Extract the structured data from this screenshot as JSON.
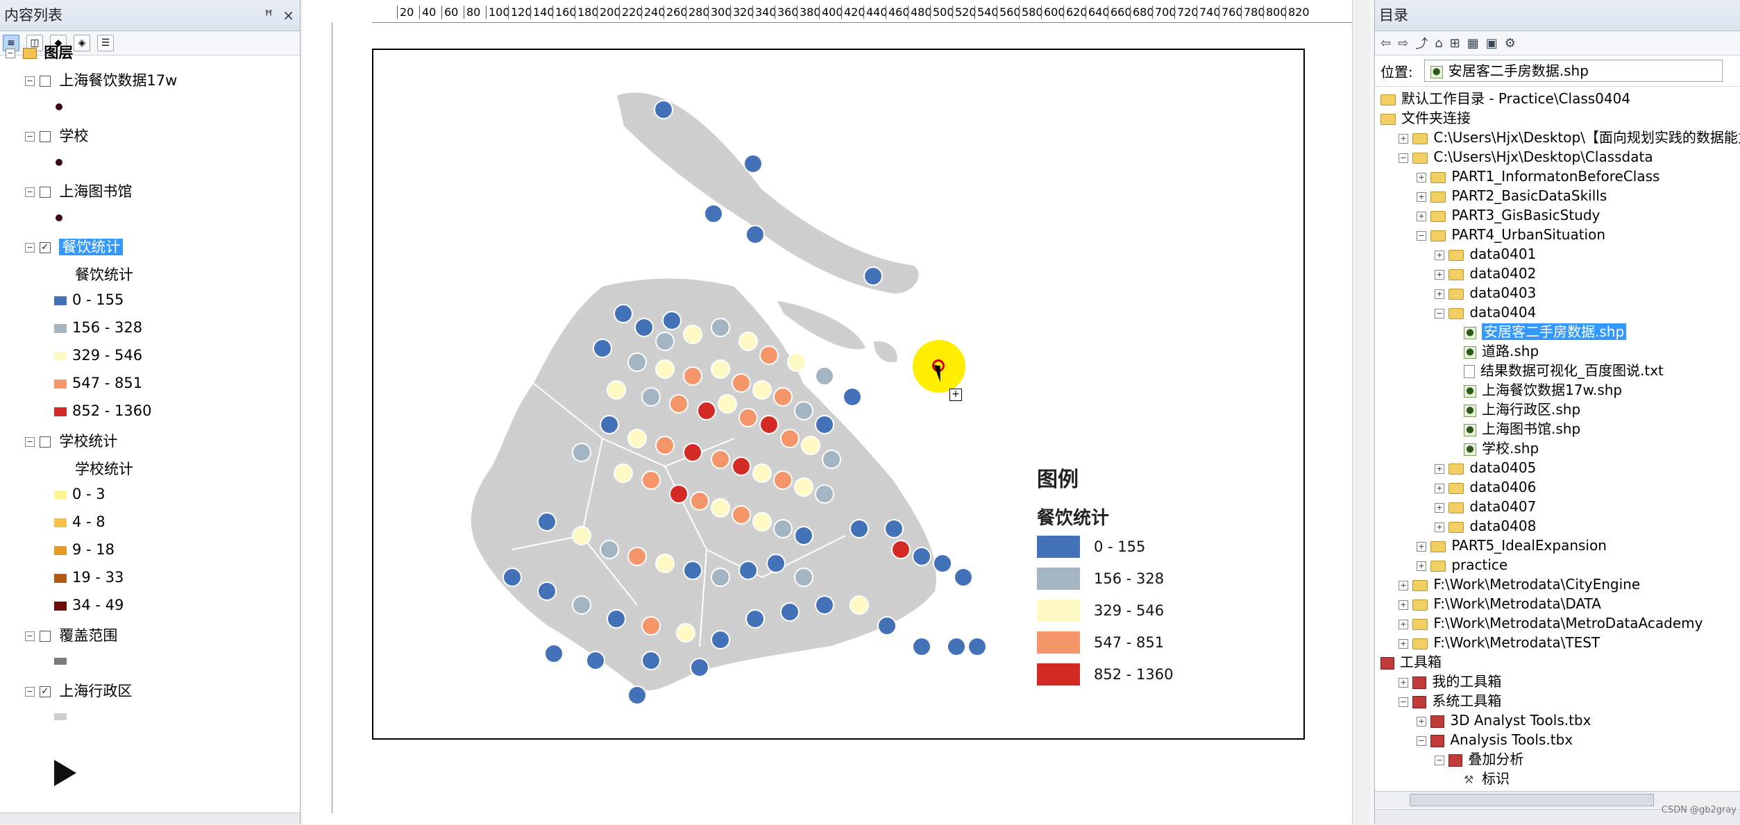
{
  "toc": {
    "title": "内容列表",
    "pin_label": "ᵖ",
    "close_label": "×",
    "root_layer": "图层",
    "layers": [
      {
        "name": "上海餐饮数据17w",
        "checked": false
      },
      {
        "name": "学校",
        "checked": false
      },
      {
        "name": "上海图书馆",
        "checked": false
      },
      {
        "name": "餐饮统计",
        "checked": true,
        "field": "餐饮统计",
        "classes": [
          {
            "label": "0 - 155",
            "color": "#4472b8"
          },
          {
            "label": "156 - 328",
            "color": "#a3b4c2"
          },
          {
            "label": "329 - 546",
            "color": "#fff9c4"
          },
          {
            "label": "547 - 851",
            "color": "#f4956a"
          },
          {
            "label": "852 - 1360",
            "color": "#d42a25"
          }
        ]
      },
      {
        "name": "学校统计",
        "checked": false,
        "field": "学校统计",
        "classes": [
          {
            "label": "0 - 3",
            "color": "#fff68f"
          },
          {
            "label": "4 - 8",
            "color": "#f5c24a"
          },
          {
            "label": "9 - 18",
            "color": "#e79a25"
          },
          {
            "label": "19 - 33",
            "color": "#b35a12"
          },
          {
            "label": "34 - 49",
            "color": "#6d0c0c"
          }
        ]
      },
      {
        "name": "覆盖范围",
        "checked": false,
        "swatch": "#7a7a7a"
      },
      {
        "name": "上海行政区",
        "checked": true,
        "swatch": "#cfcfcf"
      }
    ]
  },
  "layout": {
    "ruler_labels": [
      "20",
      "40",
      "60",
      "80",
      "100",
      "120",
      "140",
      "160",
      "180",
      "200",
      "220",
      "240",
      "260",
      "280",
      "300",
      "320",
      "340",
      "360",
      "380",
      "400",
      "420",
      "440",
      "460",
      "480",
      "500",
      "520",
      "540",
      "560",
      "580",
      "600",
      "620",
      "640",
      "660",
      "680",
      "700",
      "720",
      "740",
      "760",
      "780",
      "800",
      "820"
    ],
    "legend": {
      "title": "图例",
      "subtitle": "餐饮统计",
      "items": [
        "0 - 155",
        "156 - 328",
        "329 - 546",
        "547 - 851",
        "852 - 1360"
      ]
    }
  },
  "catalog": {
    "title": "目录",
    "location_label": "位置:",
    "location_value": "安居客二手房数据.shp",
    "items": [
      {
        "text": "默认工作目录 - Practice\\Class0404",
        "indent": 0,
        "icon": "home",
        "pm": ""
      },
      {
        "text": "文件夹连接",
        "indent": 0,
        "icon": "folder",
        "pm": ""
      },
      {
        "text": "C:\\Users\\Hjx\\Desktop\\【面向规划实践的数据能力培",
        "indent": 1,
        "icon": "folder",
        "pm": "+"
      },
      {
        "text": "C:\\Users\\Hjx\\Desktop\\Classdata",
        "indent": 1,
        "icon": "folder",
        "pm": "-"
      },
      {
        "text": "PART1_InformatonBeforeClass",
        "indent": 2,
        "icon": "folder",
        "pm": "+"
      },
      {
        "text": "PART2_BasicDataSkills",
        "indent": 2,
        "icon": "folder",
        "pm": "+"
      },
      {
        "text": "PART3_GisBasicStudy",
        "indent": 2,
        "icon": "folder",
        "pm": "+"
      },
      {
        "text": "PART4_UrbanSituation",
        "indent": 2,
        "icon": "folder",
        "pm": "-"
      },
      {
        "text": "data0401",
        "indent": 3,
        "icon": "folder",
        "pm": "+"
      },
      {
        "text": "data0402",
        "indent": 3,
        "icon": "folder",
        "pm": "+"
      },
      {
        "text": "data0403",
        "indent": 3,
        "icon": "folder",
        "pm": "+"
      },
      {
        "text": "data0404",
        "indent": 3,
        "icon": "folder",
        "pm": "-"
      },
      {
        "text": "安居客二手房数据.shp",
        "indent": 4,
        "icon": "shp",
        "pm": "",
        "selected": true
      },
      {
        "text": "道路.shp",
        "indent": 4,
        "icon": "shp",
        "pm": ""
      },
      {
        "text": "结果数据可视化_百度图说.txt",
        "indent": 4,
        "icon": "txt",
        "pm": ""
      },
      {
        "text": "上海餐饮数据17w.shp",
        "indent": 4,
        "icon": "shp",
        "pm": ""
      },
      {
        "text": "上海行政区.shp",
        "indent": 4,
        "icon": "shp",
        "pm": ""
      },
      {
        "text": "上海图书馆.shp",
        "indent": 4,
        "icon": "shp",
        "pm": ""
      },
      {
        "text": "学校.shp",
        "indent": 4,
        "icon": "shp",
        "pm": ""
      },
      {
        "text": "data0405",
        "indent": 3,
        "icon": "folder",
        "pm": "+"
      },
      {
        "text": "data0406",
        "indent": 3,
        "icon": "folder",
        "pm": "+"
      },
      {
        "text": "data0407",
        "indent": 3,
        "icon": "folder",
        "pm": "+"
      },
      {
        "text": "data0408",
        "indent": 3,
        "icon": "folder",
        "pm": "+"
      },
      {
        "text": "PART5_IdealExpansion",
        "indent": 2,
        "icon": "folder",
        "pm": "+"
      },
      {
        "text": "practice",
        "indent": 2,
        "icon": "folder",
        "pm": "+"
      },
      {
        "text": "F:\\Work\\Metrodata\\CityEngine",
        "indent": 1,
        "icon": "folder",
        "pm": "+"
      },
      {
        "text": "F:\\Work\\Metrodata\\DATA",
        "indent": 1,
        "icon": "folder",
        "pm": "+"
      },
      {
        "text": "F:\\Work\\Metrodata\\MetroDataAcademy",
        "indent": 1,
        "icon": "folder",
        "pm": "+"
      },
      {
        "text": "F:\\Work\\Metrodata\\TEST",
        "indent": 1,
        "icon": "folder",
        "pm": "+"
      },
      {
        "text": "工具箱",
        "indent": 0,
        "icon": "tbx",
        "pm": ""
      },
      {
        "text": "我的工具箱",
        "indent": 1,
        "icon": "tbx",
        "pm": "+"
      },
      {
        "text": "系统工具箱",
        "indent": 1,
        "icon": "tbx",
        "pm": "-"
      },
      {
        "text": "3D Analyst Tools.tbx",
        "indent": 2,
        "icon": "tbx",
        "pm": "+"
      },
      {
        "text": "Analysis Tools.tbx",
        "indent": 2,
        "icon": "tbx",
        "pm": "-"
      },
      {
        "text": "叠加分析",
        "indent": 3,
        "icon": "tbx",
        "pm": "-"
      },
      {
        "text": "标识",
        "indent": 4,
        "icon": "hammer",
        "pm": ""
      }
    ],
    "watermark": "CSDN @gb2gray"
  }
}
